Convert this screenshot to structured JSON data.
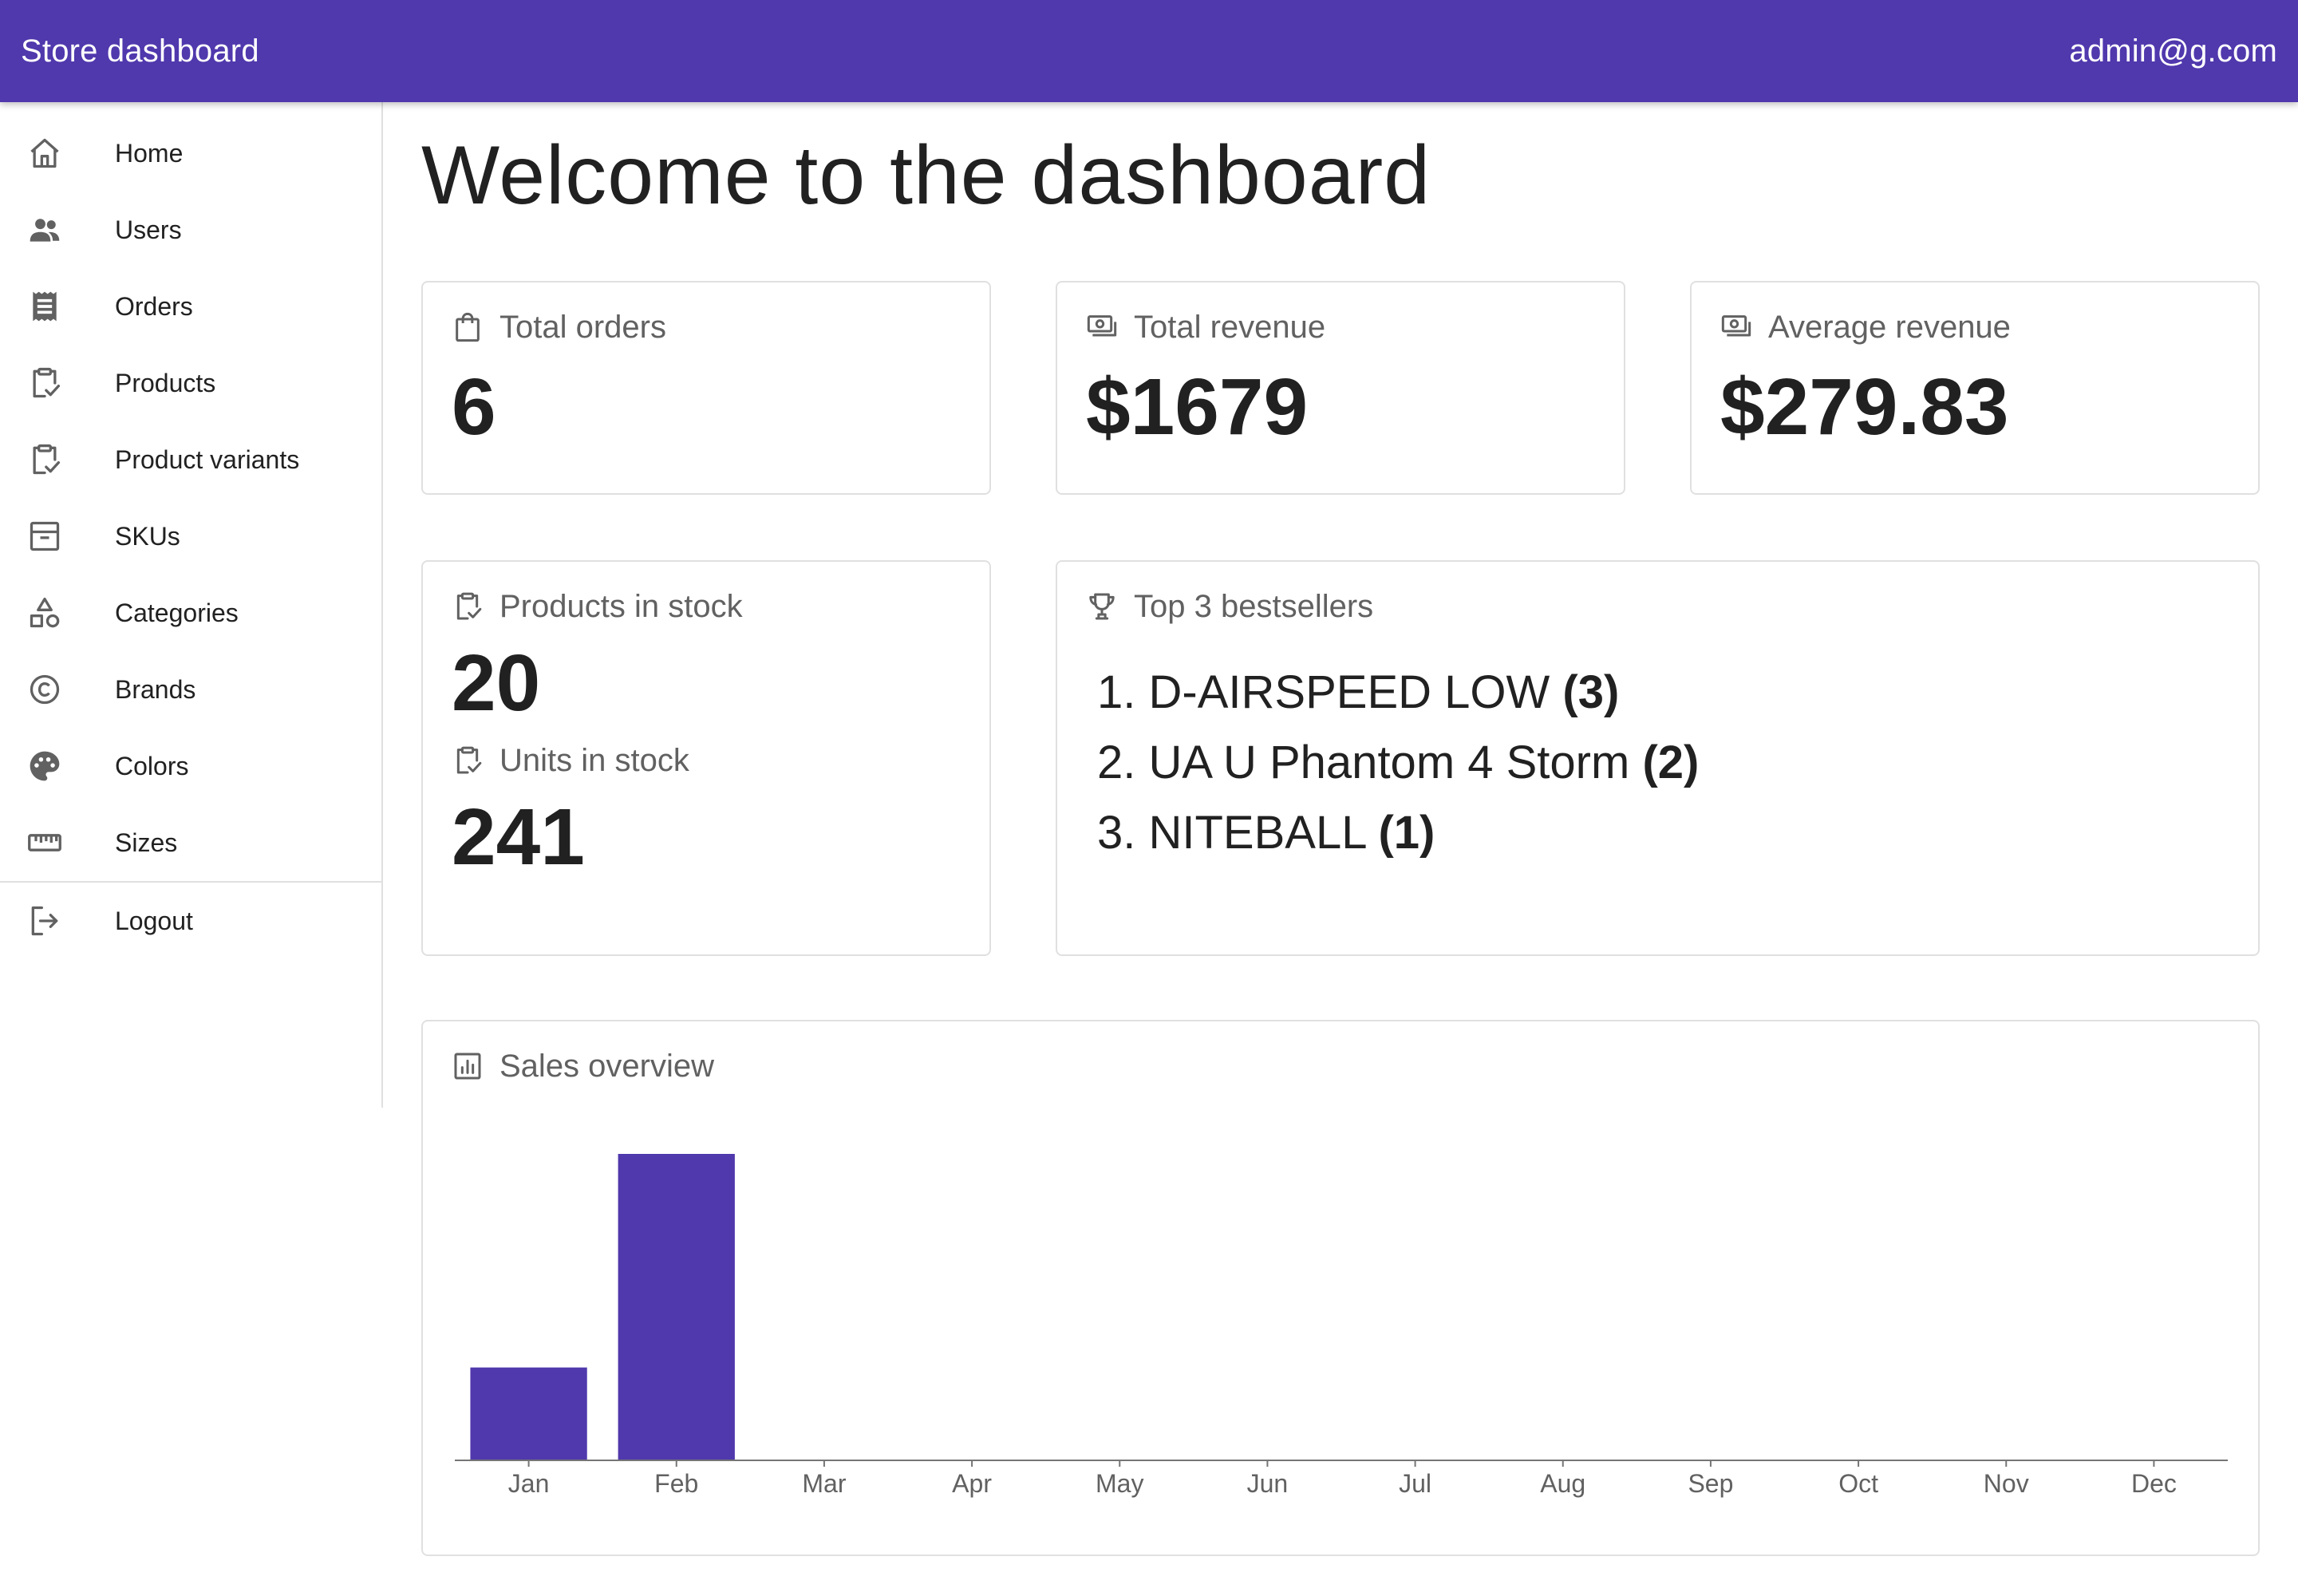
{
  "appbar": {
    "title": "Store dashboard",
    "user_email": "admin@g.com",
    "background_color": "#5038ad"
  },
  "sidebar": {
    "items": [
      {
        "label": "Home",
        "icon": "home-icon"
      },
      {
        "label": "Users",
        "icon": "users-icon"
      },
      {
        "label": "Orders",
        "icon": "receipt-icon"
      },
      {
        "label": "Products",
        "icon": "clipboard-check-icon"
      },
      {
        "label": "Product variants",
        "icon": "clipboard-check-icon"
      },
      {
        "label": "SKUs",
        "icon": "archive-box-icon"
      },
      {
        "label": "Categories",
        "icon": "shapes-icon"
      },
      {
        "label": "Brands",
        "icon": "copyright-icon"
      },
      {
        "label": "Colors",
        "icon": "palette-icon"
      },
      {
        "label": "Sizes",
        "icon": "ruler-icon"
      }
    ],
    "logout": {
      "label": "Logout",
      "icon": "logout-icon"
    }
  },
  "main": {
    "title": "Welcome to the dashboard",
    "stats": {
      "total_orders": {
        "label": "Total orders",
        "value": "6",
        "icon": "shopping-bag-icon"
      },
      "total_revenue": {
        "label": "Total revenue",
        "value": "$1679",
        "icon": "cash-icon"
      },
      "average_revenue": {
        "label": "Average revenue",
        "value": "$279.83",
        "icon": "cash-icon"
      },
      "products_in_stock": {
        "label": "Products in stock",
        "value": "20",
        "icon": "clipboard-check-icon"
      },
      "units_in_stock": {
        "label": "Units in stock",
        "value": "241",
        "icon": "clipboard-check-icon"
      }
    },
    "bestsellers": {
      "label": "Top 3 bestsellers",
      "icon": "trophy-icon",
      "items": [
        {
          "rank": "1.",
          "name": "D-AIRSPEED LOW",
          "count": "(3)"
        },
        {
          "rank": "2.",
          "name": "UA U Phantom 4 Storm",
          "count": "(2)"
        },
        {
          "rank": "3.",
          "name": "NITEBALL",
          "count": "(1)"
        }
      ]
    },
    "sales": {
      "label": "Sales overview",
      "icon": "bar-chart-icon"
    }
  },
  "chart_data": {
    "type": "bar",
    "categories": [
      "Jan",
      "Feb",
      "Mar",
      "Apr",
      "May",
      "Jun",
      "Jul",
      "Aug",
      "Sep",
      "Oct",
      "Nov",
      "Dec"
    ],
    "values": [
      1,
      3.3,
      0,
      0,
      0,
      0,
      0,
      0,
      0,
      0,
      0,
      0
    ],
    "ylim": [
      0,
      3.3
    ],
    "bar_color": "#5038ad",
    "grid": false,
    "title": "",
    "xlabel": "",
    "ylabel": ""
  }
}
